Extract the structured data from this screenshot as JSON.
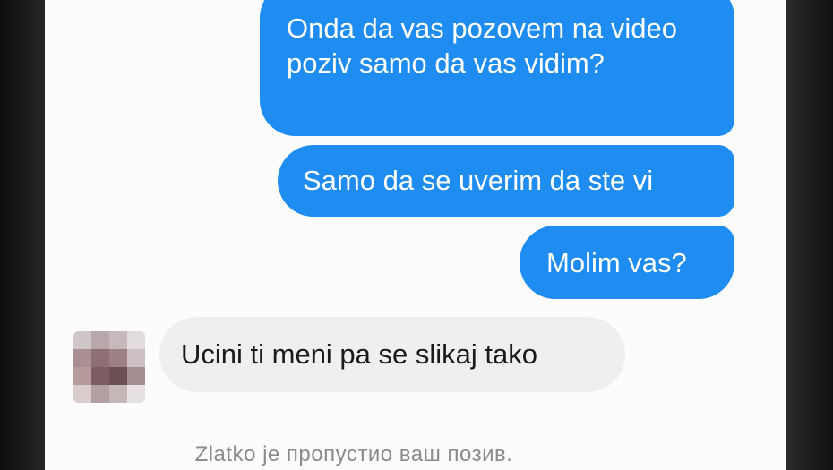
{
  "conversation": {
    "messages": [
      {
        "sender": "me",
        "text": "Onda da vas pozovem na video poziv samo da vas vidim?"
      },
      {
        "sender": "me",
        "text": "Samo da se uverim da ste vi"
      },
      {
        "sender": "me",
        "text": "Molim vas?"
      },
      {
        "sender": "contact",
        "text": "Ucini ti meni pa se slikaj tako"
      }
    ],
    "system_notice": "Zlatko je пропустио ваш позив."
  },
  "colors": {
    "outgoing_bubble": "#1e8cf0",
    "incoming_bubble": "#efefef",
    "background": "#fcfcfc"
  },
  "icons": {
    "avatar": "blurred-contact-avatar"
  }
}
